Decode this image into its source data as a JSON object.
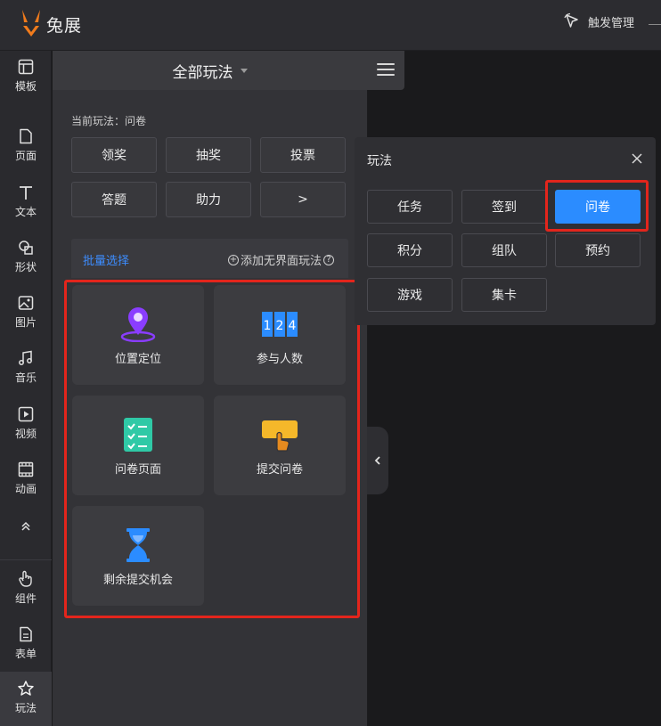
{
  "app": {
    "logo_text": "兔展",
    "trigger_label": "触发管理",
    "brand_color": "#f07b1c",
    "accent_color": "#2b8cff",
    "highlight_color": "#e3251c"
  },
  "sidebar": {
    "items": [
      {
        "label": "模板",
        "icon": "template-icon"
      },
      {
        "label": "页面",
        "icon": "page-icon"
      },
      {
        "label": "文本",
        "icon": "text-icon"
      },
      {
        "label": "形状",
        "icon": "shape-icon"
      },
      {
        "label": "图片",
        "icon": "image-icon"
      },
      {
        "label": "音乐",
        "icon": "music-icon"
      },
      {
        "label": "视频",
        "icon": "video-icon"
      },
      {
        "label": "动画",
        "icon": "animation-icon"
      },
      {
        "label": "",
        "icon": "double-chevron-up-icon"
      },
      {
        "label": "组件",
        "icon": "component-icon"
      },
      {
        "label": "表单",
        "icon": "form-icon"
      },
      {
        "label": "玩法",
        "icon": "play-star-icon",
        "active": true
      }
    ]
  },
  "panel": {
    "title": "全部玩法",
    "current_label": "当前玩法：问卷",
    "types": [
      "领奖",
      "抽奖",
      "投票",
      "答题",
      "助力",
      ">"
    ],
    "batch_select": "批量选择",
    "add_label": "添加无界面玩法",
    "cards": [
      {
        "label": "位置定位",
        "icon": "location-pin-icon"
      },
      {
        "label": "参与人数",
        "icon": "number-counter-icon"
      },
      {
        "label": "问卷页面",
        "icon": "checklist-icon"
      },
      {
        "label": "提交问卷",
        "icon": "tap-submit-icon"
      },
      {
        "label": "剩余提交机会",
        "icon": "hourglass-icon"
      }
    ]
  },
  "popup": {
    "title": "玩法",
    "buttons": [
      "任务",
      "签到",
      "问卷",
      "积分",
      "组队",
      "预约",
      "游戏",
      "集卡"
    ],
    "active": "问卷"
  }
}
